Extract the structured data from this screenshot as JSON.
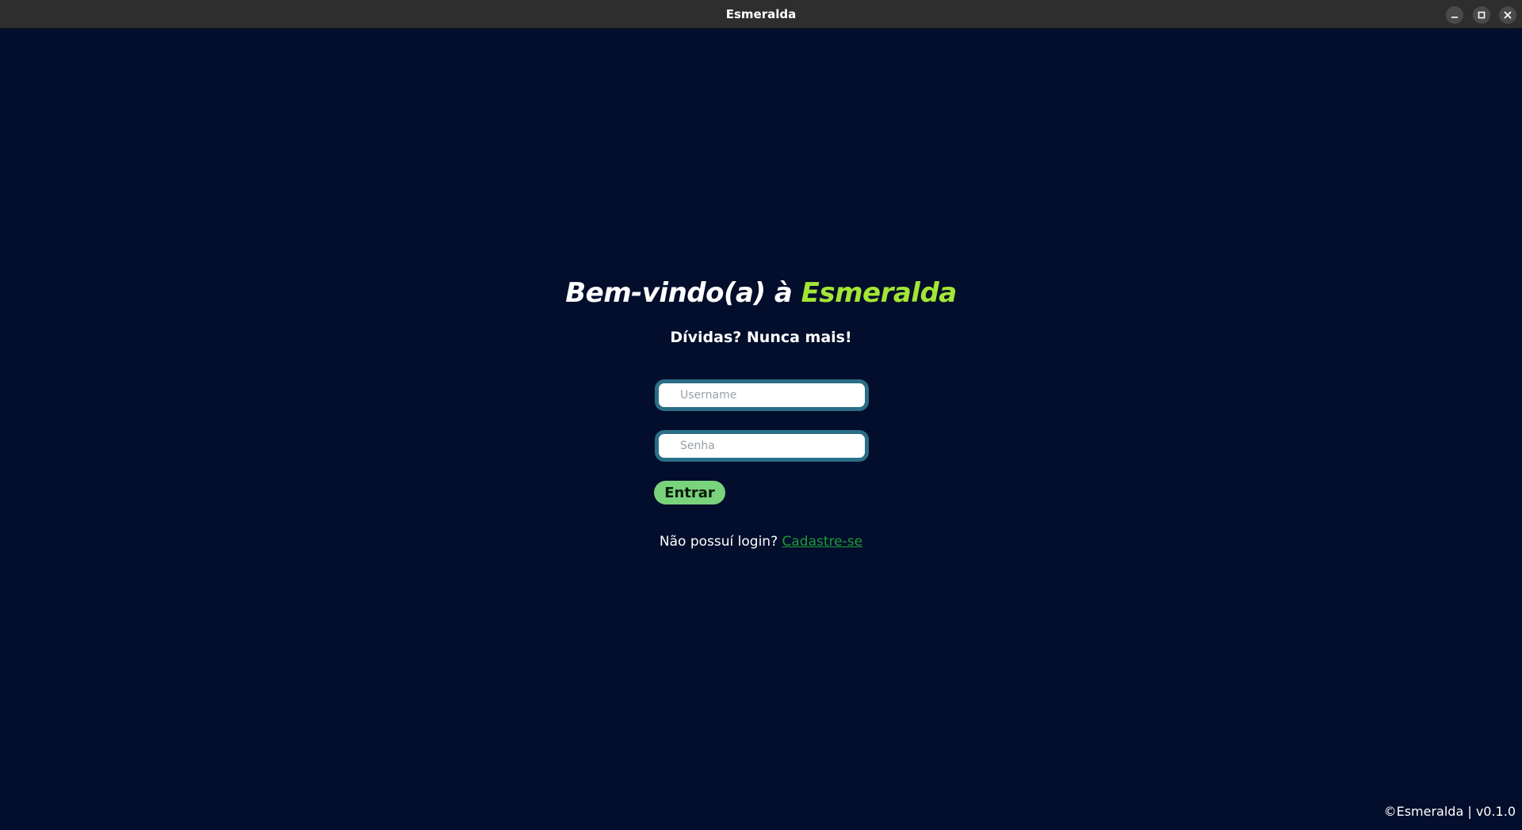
{
  "window": {
    "title": "Esmeralda",
    "controls": {
      "minimize_icon": "minimize-icon",
      "maximize_icon": "maximize-icon",
      "close_icon": "close-icon"
    }
  },
  "login": {
    "heading_prefix": "Bem-vindo(a) à ",
    "heading_brand": "Esmeralda",
    "subheading": "Dívidas? Nunca mais!",
    "username_placeholder": "Username",
    "username_value": "",
    "password_placeholder": "Senha",
    "password_value": "",
    "submit_label": "Entrar",
    "signup_prompt": "Não possuí login? ",
    "signup_link": "Cadastre-se"
  },
  "footer": {
    "text": "©Esmeralda | v0.1.0"
  },
  "colors": {
    "background": "#020e2b",
    "titlebar": "#2e2e2e",
    "brand_accent": "#a3e635",
    "input_border": "#2b6e87",
    "button": "#79d27c",
    "link": "#1f9a3a"
  }
}
